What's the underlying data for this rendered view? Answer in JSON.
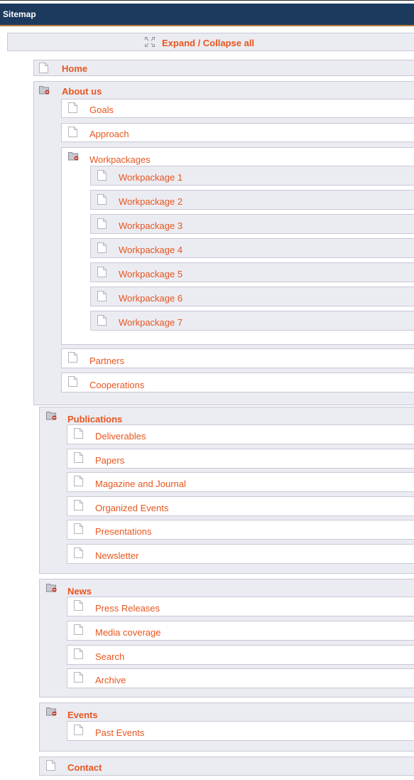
{
  "header": {
    "title": "Sitemap"
  },
  "toolbar": {
    "expand_collapse_label": "Expand / Collapse all",
    "expand_icon": "expand-collapse-icon"
  },
  "icons": {
    "page": "page-icon",
    "folder": "folder-open-icon"
  },
  "colors": {
    "link": "#e8561e",
    "titlebar": "#1c3a5e",
    "titlebar_line": "#b37a3f",
    "item_bg": "#ebebf2",
    "border": "#c9c9d6"
  },
  "sitemap": {
    "home": "Home",
    "about": {
      "label": "About us",
      "children": {
        "goals": "Goals",
        "approach": "Approach",
        "workpackages": {
          "label": "Workpackages",
          "items": [
            "Workpackage 1",
            "Workpackage 2",
            "Workpackage 3",
            "Workpackage 4",
            "Workpackage 5",
            "Workpackage 6",
            "Workpackage 7"
          ]
        },
        "partners": "Partners",
        "cooperations": "Cooperations"
      }
    },
    "publications": {
      "label": "Publications",
      "items": [
        "Deliverables",
        "Papers",
        "Magazine and Journal",
        "Organized Events",
        "Presentations",
        "Newsletter"
      ]
    },
    "news": {
      "label": "News",
      "items": [
        "Press Releases",
        "Media coverage",
        "Search",
        "Archive"
      ]
    },
    "events": {
      "label": "Events",
      "items": [
        "Past Events"
      ]
    },
    "contact": "Contact"
  }
}
